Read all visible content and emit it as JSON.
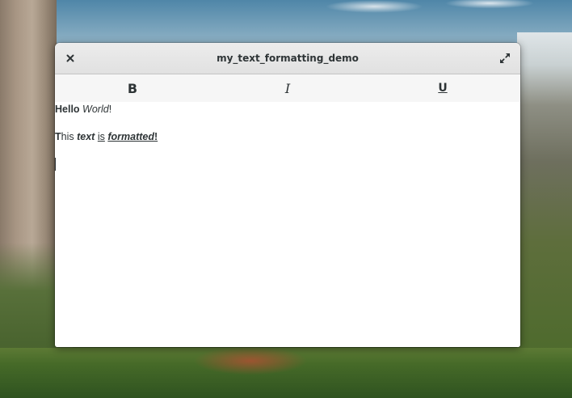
{
  "window": {
    "title": "my_text_formatting_demo",
    "close_icon": "close-icon",
    "maximize_icon": "maximize-icon"
  },
  "toolbar": {
    "bold_label": "B",
    "italic_label": "I",
    "underline_label": "U"
  },
  "editor": {
    "line1": {
      "hello": "Hello",
      "space": " ",
      "world": "World",
      "bang": "!"
    },
    "line3": {
      "t": "T",
      "his": "his",
      "space1": " ",
      "text": "text",
      "space2": " ",
      "is": "is",
      "space3": " ",
      "formatted": "formatted",
      "bang": "!"
    }
  },
  "colors": {
    "text": "#2e3436",
    "headerbar": "#e1e1e1",
    "toolbar": "#f6f6f6"
  }
}
